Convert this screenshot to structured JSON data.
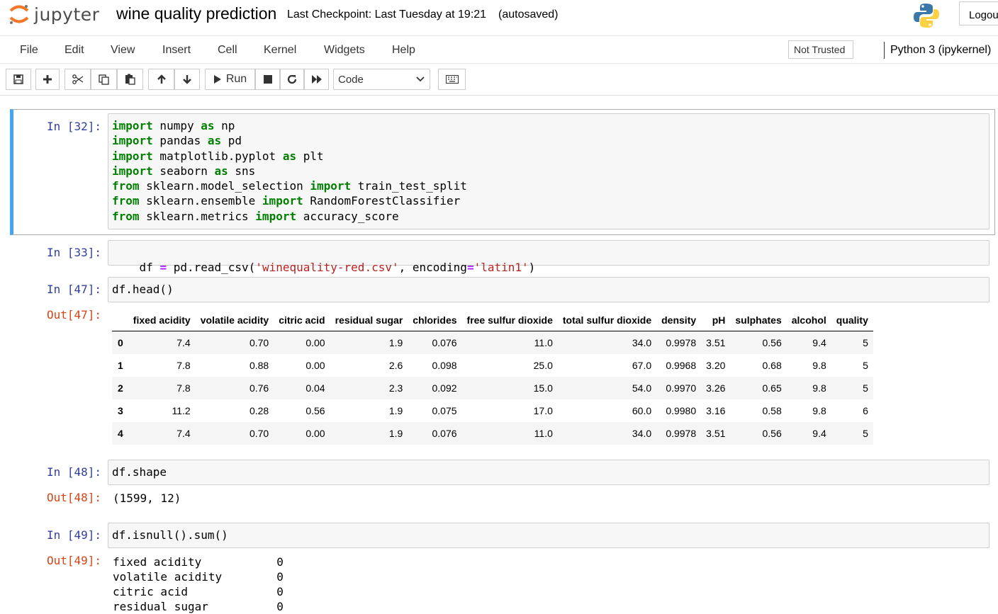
{
  "header": {
    "logo_text": "jupyter",
    "notebook_title": "wine quality prediction",
    "checkpoint": "Last Checkpoint: Last Tuesday at 19:21",
    "autosave": "(autosaved)",
    "logout_label": "Logout"
  },
  "menu": {
    "items": [
      "File",
      "Edit",
      "View",
      "Insert",
      "Cell",
      "Kernel",
      "Widgets",
      "Help"
    ],
    "trust_label": "Not Trusted",
    "kernel_label": "Python 3 (ipykernel)"
  },
  "toolbar": {
    "run_label": "Run",
    "cell_type": "Code",
    "icons": [
      "save-icon",
      "plus-icon",
      "scissors-icon",
      "copy-icon",
      "paste-icon",
      "arrow-up-icon",
      "arrow-down-icon",
      "play-icon",
      "stop-icon",
      "restart-icon",
      "fast-forward-icon",
      "keyboard-icon"
    ]
  },
  "cells": {
    "c32": {
      "prompt": "In [32]:"
    },
    "c33": {
      "prompt": "In [33]:"
    },
    "c47": {
      "prompt": "In [47]:",
      "out_prompt": "Out[47]:"
    },
    "c48": {
      "prompt": "In [48]:",
      "out_prompt": "Out[48]:",
      "code": "df.shape",
      "output": "(1599, 12)"
    },
    "c49": {
      "prompt": "In [49]:",
      "out_prompt": "Out[49]:",
      "code": "df.isnull().sum()",
      "output": "fixed acidity           0\nvolatile acidity        0\ncitric acid             0\nresidual sugar          0"
    }
  },
  "code": {
    "c32": [
      {
        "kw": "import",
        "rest": " numpy ",
        "kw2": "as",
        "tail": " np"
      },
      {
        "kw": "import",
        "rest": " pandas ",
        "kw2": "as",
        "tail": " pd"
      },
      {
        "kw": "import",
        "rest": " matplotlib.pyplot ",
        "kw2": "as",
        "tail": " plt"
      },
      {
        "kw": "import",
        "rest": " seaborn ",
        "kw2": "as",
        "tail": " sns"
      },
      {
        "kw": "from",
        "rest": " sklearn.model_selection ",
        "kw2": "import",
        "tail": " train_test_split"
      },
      {
        "kw": "from",
        "rest": " sklearn.ensemble ",
        "kw2": "import",
        "tail": " RandomForestClassifier"
      },
      {
        "kw": "from",
        "rest": " sklearn.metrics ",
        "kw2": "import",
        "tail": " accuracy_score"
      }
    ],
    "c33": {
      "a": "df ",
      "op1": "=",
      "b": " pd.read_csv(",
      "s1": "'winequality-red.csv'",
      "c": ", encoding",
      "op2": "=",
      "s2": "'latin1'",
      "d": ")"
    },
    "c47": "df.head()"
  },
  "dataframe": {
    "columns": [
      "fixed acidity",
      "volatile acidity",
      "citric acid",
      "residual sugar",
      "chlorides",
      "free sulfur dioxide",
      "total sulfur dioxide",
      "density",
      "pH",
      "sulphates",
      "alcohol",
      "quality"
    ],
    "rows": [
      {
        "index": "0",
        "values": [
          "7.4",
          "0.70",
          "0.00",
          "1.9",
          "0.076",
          "11.0",
          "34.0",
          "0.9978",
          "3.51",
          "0.56",
          "9.4",
          "5"
        ]
      },
      {
        "index": "1",
        "values": [
          "7.8",
          "0.88",
          "0.00",
          "2.6",
          "0.098",
          "25.0",
          "67.0",
          "0.9968",
          "3.20",
          "0.68",
          "9.8",
          "5"
        ]
      },
      {
        "index": "2",
        "values": [
          "7.8",
          "0.76",
          "0.04",
          "2.3",
          "0.092",
          "15.0",
          "54.0",
          "0.9970",
          "3.26",
          "0.65",
          "9.8",
          "5"
        ]
      },
      {
        "index": "3",
        "values": [
          "11.2",
          "0.28",
          "0.56",
          "1.9",
          "0.075",
          "17.0",
          "60.0",
          "0.9980",
          "3.16",
          "0.58",
          "9.8",
          "6"
        ]
      },
      {
        "index": "4",
        "values": [
          "7.4",
          "0.70",
          "0.00",
          "1.9",
          "0.076",
          "11.0",
          "34.0",
          "0.9978",
          "3.51",
          "0.56",
          "9.4",
          "5"
        ]
      }
    ]
  }
}
